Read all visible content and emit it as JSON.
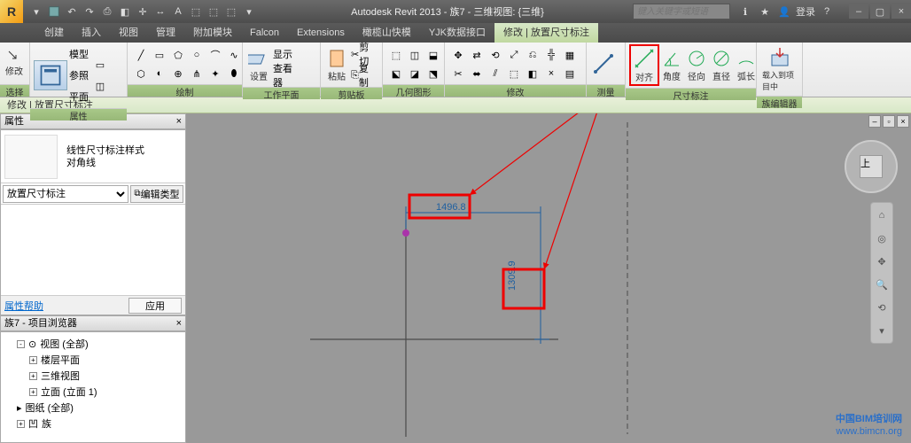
{
  "title": "Autodesk Revit 2013 -   族7 - 三维视图: {三维}",
  "search_placeholder": "键入关键字或短语",
  "login_label": "登录",
  "menu_tabs": [
    "创建",
    "插入",
    "视图",
    "管理",
    "附加模块",
    "Falcon",
    "Extensions",
    "橄榄山快模",
    "YJK数据接口",
    "修改 | 放置尺寸标注"
  ],
  "active_tab_index": 9,
  "ribbon": {
    "panels": [
      {
        "label": "选择",
        "items": [
          "修改"
        ]
      },
      {
        "label": "属性",
        "items": [
          "属性"
        ]
      },
      {
        "label": "绘制",
        "items": []
      },
      {
        "label": "工作平面",
        "items": [
          "设置",
          "显示",
          "查看器"
        ]
      },
      {
        "label": "剪贴板",
        "items": [
          "粘贴",
          "剪切",
          "复制"
        ]
      },
      {
        "label": "几何图形",
        "items": []
      },
      {
        "label": "修改",
        "items": []
      },
      {
        "label": "测量",
        "items": []
      },
      {
        "label": "尺寸标注",
        "items": [
          "对齐",
          "角度",
          "径向",
          "直径",
          "弧长"
        ]
      },
      {
        "label": "族编辑器",
        "items": [
          "载入到项目中"
        ]
      }
    ]
  },
  "context_label": "修改 | 放置尺寸标注",
  "properties": {
    "header": "属性",
    "type_name_1": "线性尺寸标注样式",
    "type_name_2": "对角线",
    "selector": "放置尺寸标注",
    "edit_type": "编辑类型",
    "help": "属性帮助",
    "apply": "应用"
  },
  "browser": {
    "header": "族7 - 项目浏览器",
    "items": [
      {
        "label": "视图 (全部)",
        "level": 0,
        "expand": "-"
      },
      {
        "label": "楼层平面",
        "level": 1,
        "expand": "+"
      },
      {
        "label": "三维视图",
        "level": 1,
        "expand": "+"
      },
      {
        "label": "立面 (立面 1)",
        "level": 1,
        "expand": "+"
      },
      {
        "label": "图纸 (全部)",
        "level": 0,
        "expand": ""
      },
      {
        "label": "族",
        "level": 0,
        "expand": "+"
      }
    ]
  },
  "canvas": {
    "dim1": "1496.8",
    "dim2": "1309.9"
  },
  "watermark": {
    "line1": "中国BIM培训网",
    "line2": "www.bimcn.org"
  }
}
